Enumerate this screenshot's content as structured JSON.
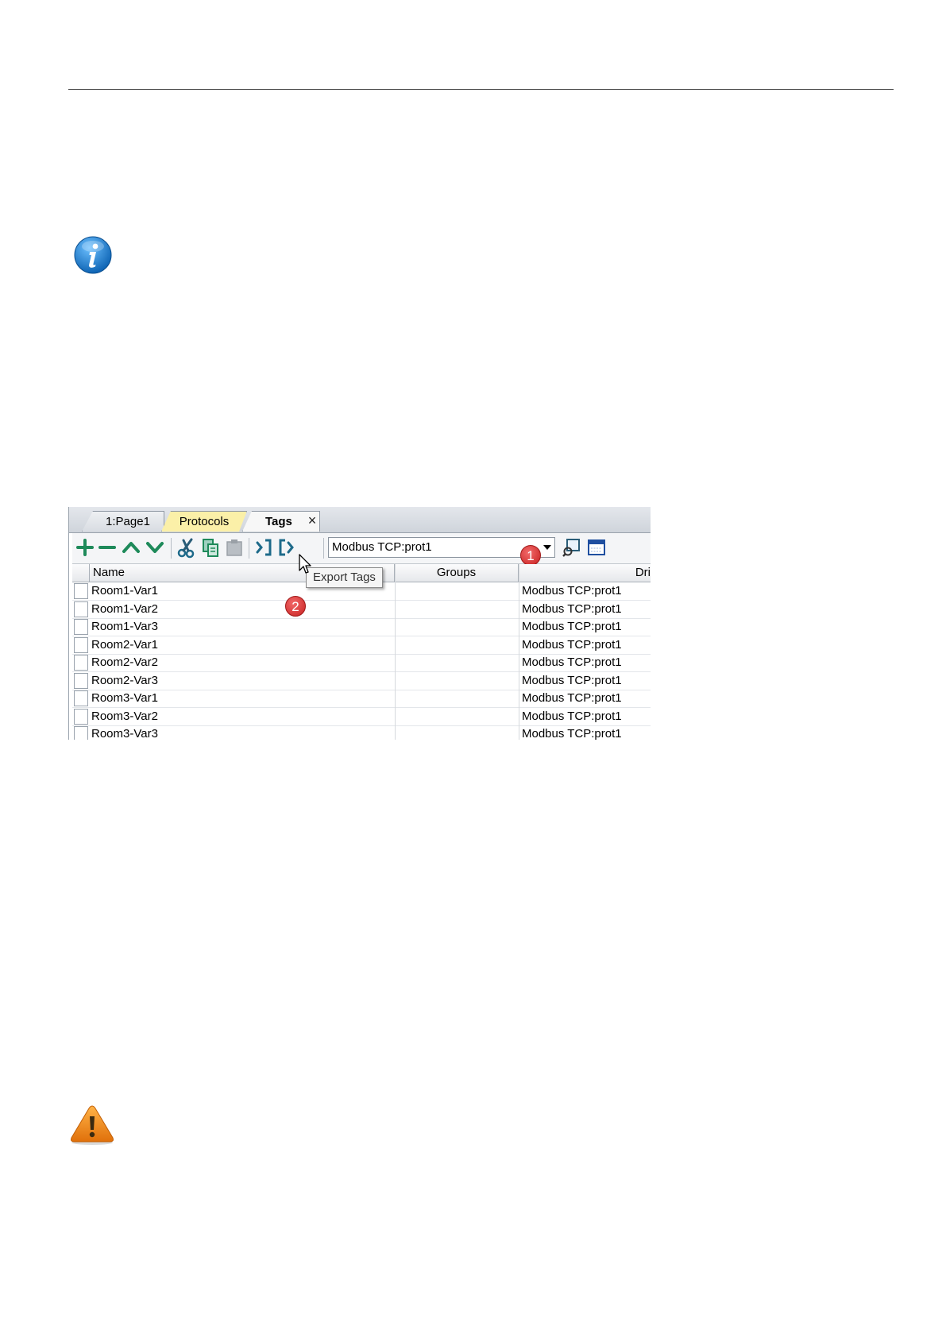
{
  "tabs": [
    {
      "label": "1:Page1"
    },
    {
      "label": "Protocols"
    },
    {
      "label": "Tags"
    }
  ],
  "tab_close_label": "×",
  "toolbar": {
    "protocol_combo_value": "Modbus TCP:prot1",
    "icons": [
      "add-icon",
      "remove-icon",
      "move-up-icon",
      "move-down-icon",
      "cut-icon",
      "copy-icon",
      "paste-icon",
      "import-tags-icon",
      "export-tags-icon",
      "tag-browse-icon",
      "window-icon"
    ]
  },
  "tooltip": "Export Tags",
  "callouts": [
    "1",
    "2"
  ],
  "grid": {
    "columns": [
      "Name",
      "Groups",
      "Dri"
    ],
    "rows": [
      {
        "name": "Room1-Var1",
        "groups": "",
        "driver": "Modbus TCP:prot1"
      },
      {
        "name": "Room1-Var2",
        "groups": "",
        "driver": "Modbus TCP:prot1"
      },
      {
        "name": "Room1-Var3",
        "groups": "",
        "driver": "Modbus TCP:prot1"
      },
      {
        "name": "Room2-Var1",
        "groups": "",
        "driver": "Modbus TCP:prot1"
      },
      {
        "name": "Room2-Var2",
        "groups": "",
        "driver": "Modbus TCP:prot1"
      },
      {
        "name": "Room2-Var3",
        "groups": "",
        "driver": "Modbus TCP:prot1"
      },
      {
        "name": "Room3-Var1",
        "groups": "",
        "driver": "Modbus TCP:prot1"
      },
      {
        "name": "Room3-Var2",
        "groups": "",
        "driver": "Modbus TCP:prot1"
      },
      {
        "name": "Room3-Var3",
        "groups": "",
        "driver": "Modbus TCP:prot1"
      }
    ]
  },
  "colors": {
    "accent_green": "#1e8a5a",
    "badge_red": "#d42a2a",
    "protocols_tab": "#fbf0a8",
    "info_blue": "#1f7fd0",
    "warning_orange": "#f08c14"
  }
}
